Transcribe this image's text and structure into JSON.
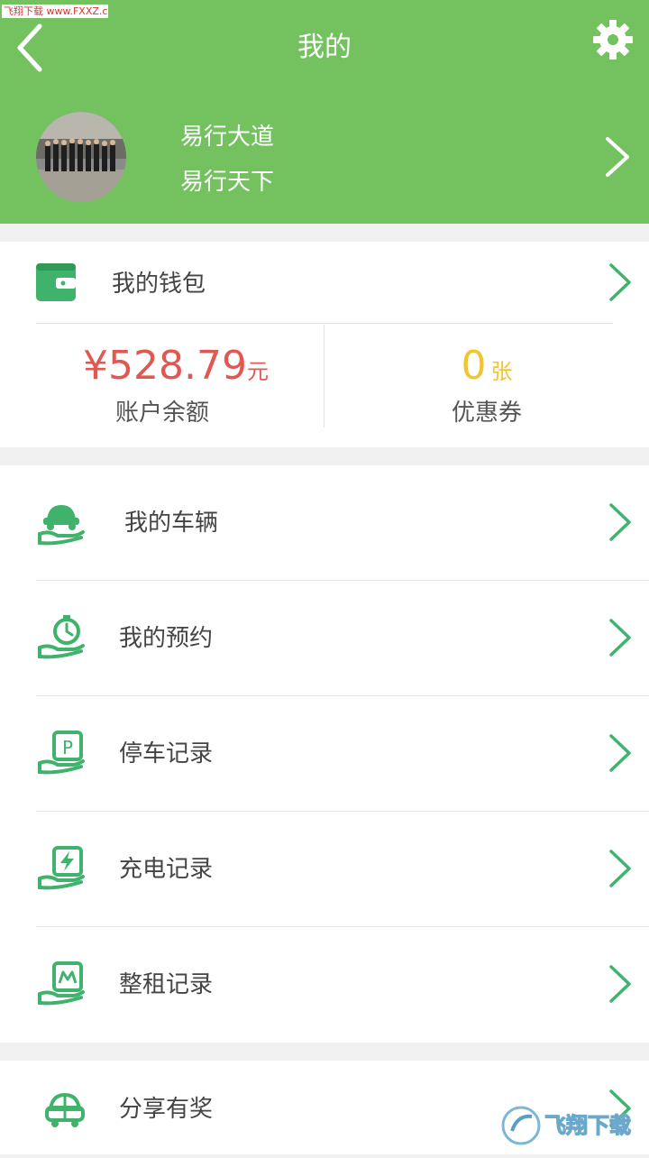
{
  "watermark_top": "飞翔下载 www.FXXZ.com",
  "header": {
    "title": "我的",
    "back_icon": "chevron-left-icon",
    "settings_icon": "gear-icon"
  },
  "profile": {
    "line1": "易行大道",
    "line2": "易行天下"
  },
  "wallet": {
    "label": "我的钱包",
    "balance_amount": "¥528.79",
    "balance_unit": "元",
    "balance_label": "账户余额",
    "coupon_count": "0",
    "coupon_unit": "张",
    "coupon_label": "优惠券",
    "balance_color": "#e0584f",
    "coupon_color": "#f4c430"
  },
  "menu": [
    {
      "label": "我的车辆",
      "icon": "car-hand-icon"
    },
    {
      "label": "我的预约",
      "icon": "clock-hand-icon"
    },
    {
      "label": "停车记录",
      "icon": "parking-hand-icon"
    },
    {
      "label": "充电记录",
      "icon": "charging-hand-icon"
    },
    {
      "label": "整租记录",
      "icon": "rental-hand-icon"
    }
  ],
  "share": {
    "label": "分享有奖",
    "icon": "gift-car-icon"
  },
  "watermark_logo": "飞翔下载",
  "colors": {
    "accent": "#73c25f",
    "icon_green": "#3fb36b"
  }
}
